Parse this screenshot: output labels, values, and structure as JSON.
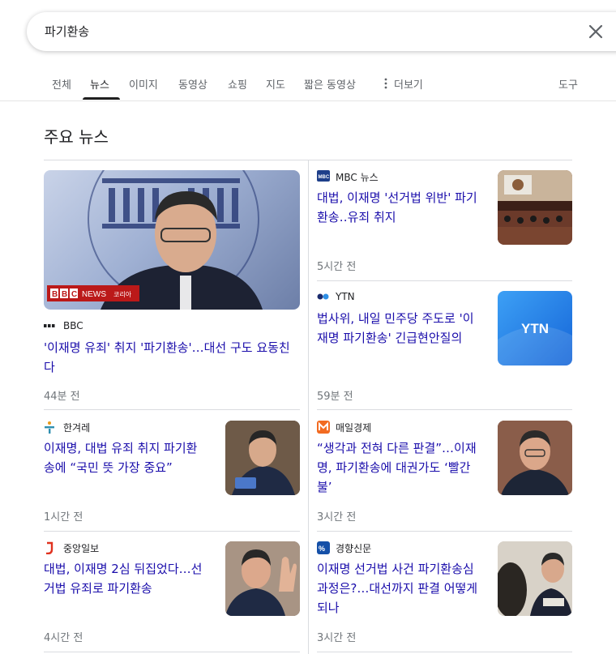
{
  "search": {
    "query": "파기환송"
  },
  "tabs": [
    {
      "label": "전체"
    },
    {
      "label": "뉴스"
    },
    {
      "label": "이미지"
    },
    {
      "label": "동영상"
    },
    {
      "label": "쇼핑"
    },
    {
      "label": "지도"
    },
    {
      "label": "짧은 동영상"
    },
    {
      "label": "더보기"
    },
    {
      "label": "도구"
    }
  ],
  "section_title": "주요 뉴스",
  "articles": [
    {
      "source": "BBC",
      "headline_1": "'이재명 유죄' 취지 '파기환송'…대선 구도 요동친",
      "headline_2": "다",
      "time": "44분 전",
      "image_badge_brand": "BBC",
      "image_badge_news": "NEWS",
      "image_badge_region": "코리아"
    },
    {
      "source": "MBC 뉴스",
      "headline_1": "대법, 이재명 '선거법 위반' 파기",
      "headline_2": "환송‥유죄 취지",
      "time": "5시간 전"
    },
    {
      "source": "YTN",
      "headline_1": "법사위, 내일 민주당 주도로 '이",
      "headline_2": "재명 파기환송' 긴급현안질의",
      "time": "59분 전",
      "image_text": "YTN"
    },
    {
      "source": "한겨레",
      "headline_1": "이재명, 대법 유죄 취지 파기환",
      "headline_2": "송에 “국민 뜻 가장 중요”",
      "time": "1시간 전"
    },
    {
      "source": "매일경제",
      "headline_1": "“생각과 전혀 다른 판결”…이재",
      "headline_2": "명, 파기환송에 대권가도 ‘빨간",
      "headline_3": "불’",
      "time": "3시간 전"
    },
    {
      "source": "중앙일보",
      "headline_1": "대법, 이재명 2심 뒤집었다…선",
      "headline_2": "거법 유죄로 파기환송",
      "time": "4시간 전"
    },
    {
      "source": "경향신문",
      "headline_1": "이재명 선거법 사건 파기환송심",
      "headline_2": "과정은?…대선까지 판결 어떻게",
      "headline_3": "되나",
      "time": "3시간 전"
    }
  ]
}
